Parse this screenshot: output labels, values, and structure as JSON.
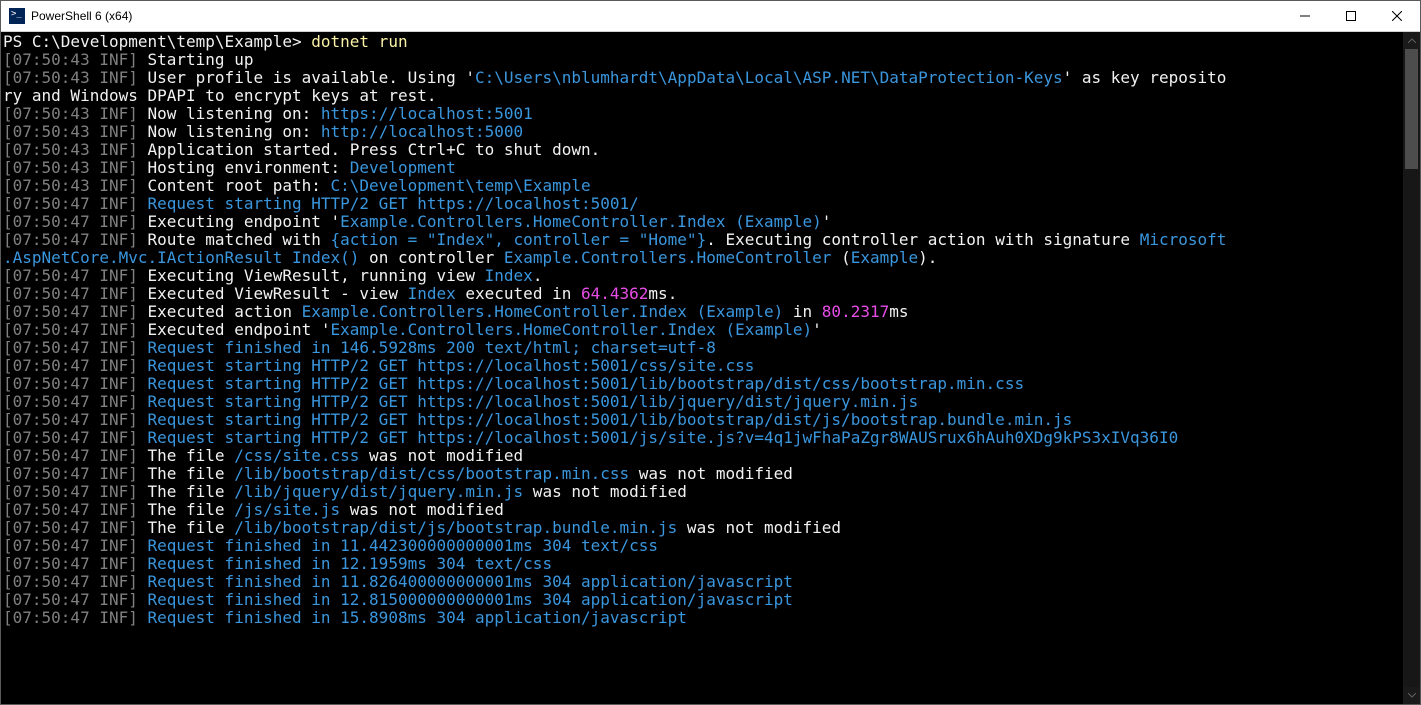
{
  "window": {
    "title": "PowerShell 6 (x64)"
  },
  "prompt": {
    "prefix": "PS ",
    "path": "C:\\Development\\temp\\Example",
    "suffix": "> ",
    "command": "dotnet run"
  },
  "lines": [
    {
      "ts": "[07:50:43 INF]",
      "segs": [
        {
          "c": "white",
          "t": " Starting up"
        }
      ]
    },
    {
      "ts": "[07:50:43 INF]",
      "segs": [
        {
          "c": "white",
          "t": " User profile is available. Using '"
        },
        {
          "c": "cyan",
          "t": "C:\\Users\\nblumhardt\\AppData\\Local\\ASP.NET\\DataProtection-Keys"
        },
        {
          "c": "white",
          "t": "' as key reposito"
        }
      ]
    },
    {
      "ts": "",
      "segs": [
        {
          "c": "white",
          "t": "ry and Windows DPAPI to encrypt keys at rest."
        }
      ]
    },
    {
      "ts": "[07:50:43 INF]",
      "segs": [
        {
          "c": "white",
          "t": " Now listening on: "
        },
        {
          "c": "cyan",
          "t": "https://localhost:5001"
        }
      ]
    },
    {
      "ts": "[07:50:43 INF]",
      "segs": [
        {
          "c": "white",
          "t": " Now listening on: "
        },
        {
          "c": "cyan",
          "t": "http://localhost:5000"
        }
      ]
    },
    {
      "ts": "[07:50:43 INF]",
      "segs": [
        {
          "c": "white",
          "t": " Application started. Press Ctrl+C to shut down."
        }
      ]
    },
    {
      "ts": "[07:50:43 INF]",
      "segs": [
        {
          "c": "white",
          "t": " Hosting environment: "
        },
        {
          "c": "cyan",
          "t": "Development"
        }
      ]
    },
    {
      "ts": "[07:50:43 INF]",
      "segs": [
        {
          "c": "white",
          "t": " Content root path: "
        },
        {
          "c": "cyan",
          "t": "C:\\Development\\temp\\Example"
        }
      ]
    },
    {
      "ts": "[07:50:47 INF]",
      "segs": [
        {
          "c": "cyan",
          "t": " Request starting HTTP/2 GET https://localhost:5001/"
        }
      ]
    },
    {
      "ts": "[07:50:47 INF]",
      "segs": [
        {
          "c": "white",
          "t": " Executing endpoint '"
        },
        {
          "c": "cyan",
          "t": "Example.Controllers.HomeController.Index (Example)"
        },
        {
          "c": "white",
          "t": "'"
        }
      ]
    },
    {
      "ts": "[07:50:47 INF]",
      "segs": [
        {
          "c": "white",
          "t": " Route matched with "
        },
        {
          "c": "cyan",
          "t": "{action = \"Index\", controller = \"Home\"}"
        },
        {
          "c": "white",
          "t": ". Executing controller action with signature "
        },
        {
          "c": "cyan",
          "t": "Microsoft"
        }
      ]
    },
    {
      "ts": "",
      "segs": [
        {
          "c": "cyan",
          "t": ".AspNetCore.Mvc.IActionResult Index()"
        },
        {
          "c": "white",
          "t": " on controller "
        },
        {
          "c": "cyan",
          "t": "Example.Controllers.HomeController"
        },
        {
          "c": "white",
          "t": " ("
        },
        {
          "c": "cyan",
          "t": "Example"
        },
        {
          "c": "white",
          "t": ")."
        }
      ]
    },
    {
      "ts": "[07:50:47 INF]",
      "segs": [
        {
          "c": "white",
          "t": " Executing ViewResult, running view "
        },
        {
          "c": "cyan",
          "t": "Index"
        },
        {
          "c": "white",
          "t": "."
        }
      ]
    },
    {
      "ts": "[07:50:47 INF]",
      "segs": [
        {
          "c": "white",
          "t": " Executed ViewResult - view "
        },
        {
          "c": "cyan",
          "t": "Index"
        },
        {
          "c": "white",
          "t": " executed in "
        },
        {
          "c": "magenta",
          "t": "64.4362"
        },
        {
          "c": "white",
          "t": "ms."
        }
      ]
    },
    {
      "ts": "[07:50:47 INF]",
      "segs": [
        {
          "c": "white",
          "t": " Executed action "
        },
        {
          "c": "cyan",
          "t": "Example.Controllers.HomeController.Index (Example)"
        },
        {
          "c": "white",
          "t": " in "
        },
        {
          "c": "magenta",
          "t": "80.2317"
        },
        {
          "c": "white",
          "t": "ms"
        }
      ]
    },
    {
      "ts": "[07:50:47 INF]",
      "segs": [
        {
          "c": "white",
          "t": " Executed endpoint '"
        },
        {
          "c": "cyan",
          "t": "Example.Controllers.HomeController.Index (Example)"
        },
        {
          "c": "white",
          "t": "'"
        }
      ]
    },
    {
      "ts": "[07:50:47 INF]",
      "segs": [
        {
          "c": "cyan",
          "t": " Request finished in 146.5928ms 200 text/html; charset=utf-8"
        }
      ]
    },
    {
      "ts": "[07:50:47 INF]",
      "segs": [
        {
          "c": "cyan",
          "t": " Request starting HTTP/2 GET https://localhost:5001/css/site.css"
        }
      ]
    },
    {
      "ts": "[07:50:47 INF]",
      "segs": [
        {
          "c": "cyan",
          "t": " Request starting HTTP/2 GET https://localhost:5001/lib/bootstrap/dist/css/bootstrap.min.css"
        }
      ]
    },
    {
      "ts": "[07:50:47 INF]",
      "segs": [
        {
          "c": "cyan",
          "t": " Request starting HTTP/2 GET https://localhost:5001/lib/jquery/dist/jquery.min.js"
        }
      ]
    },
    {
      "ts": "[07:50:47 INF]",
      "segs": [
        {
          "c": "cyan",
          "t": " Request starting HTTP/2 GET https://localhost:5001/lib/bootstrap/dist/js/bootstrap.bundle.min.js"
        }
      ]
    },
    {
      "ts": "[07:50:47 INF]",
      "segs": [
        {
          "c": "cyan",
          "t": " Request starting HTTP/2 GET https://localhost:5001/js/site.js?v=4q1jwFhaPaZgr8WAUSrux6hAuh0XDg9kPS3xIVq36I0"
        }
      ]
    },
    {
      "ts": "[07:50:47 INF]",
      "segs": [
        {
          "c": "white",
          "t": " The file "
        },
        {
          "c": "cyan",
          "t": "/css/site.css"
        },
        {
          "c": "white",
          "t": " was not modified"
        }
      ]
    },
    {
      "ts": "[07:50:47 INF]",
      "segs": [
        {
          "c": "white",
          "t": " The file "
        },
        {
          "c": "cyan",
          "t": "/lib/bootstrap/dist/css/bootstrap.min.css"
        },
        {
          "c": "white",
          "t": " was not modified"
        }
      ]
    },
    {
      "ts": "[07:50:47 INF]",
      "segs": [
        {
          "c": "white",
          "t": " The file "
        },
        {
          "c": "cyan",
          "t": "/lib/jquery/dist/jquery.min.js"
        },
        {
          "c": "white",
          "t": " was not modified"
        }
      ]
    },
    {
      "ts": "[07:50:47 INF]",
      "segs": [
        {
          "c": "white",
          "t": " The file "
        },
        {
          "c": "cyan",
          "t": "/js/site.js"
        },
        {
          "c": "white",
          "t": " was not modified"
        }
      ]
    },
    {
      "ts": "[07:50:47 INF]",
      "segs": [
        {
          "c": "white",
          "t": " The file "
        },
        {
          "c": "cyan",
          "t": "/lib/bootstrap/dist/js/bootstrap.bundle.min.js"
        },
        {
          "c": "white",
          "t": " was not modified"
        }
      ]
    },
    {
      "ts": "[07:50:47 INF]",
      "segs": [
        {
          "c": "cyan",
          "t": " Request finished in 11.442300000000001ms 304 text/css"
        }
      ]
    },
    {
      "ts": "[07:50:47 INF]",
      "segs": [
        {
          "c": "cyan",
          "t": " Request finished in 12.1959ms 304 text/css"
        }
      ]
    },
    {
      "ts": "[07:50:47 INF]",
      "segs": [
        {
          "c": "cyan",
          "t": " Request finished in 11.826400000000001ms 304 application/javascript"
        }
      ]
    },
    {
      "ts": "[07:50:47 INF]",
      "segs": [
        {
          "c": "cyan",
          "t": " Request finished in 12.815000000000001ms 304 application/javascript"
        }
      ]
    },
    {
      "ts": "[07:50:47 INF]",
      "segs": [
        {
          "c": "cyan",
          "t": " Request finished in 15.8908ms 304 application/javascript"
        }
      ]
    }
  ]
}
